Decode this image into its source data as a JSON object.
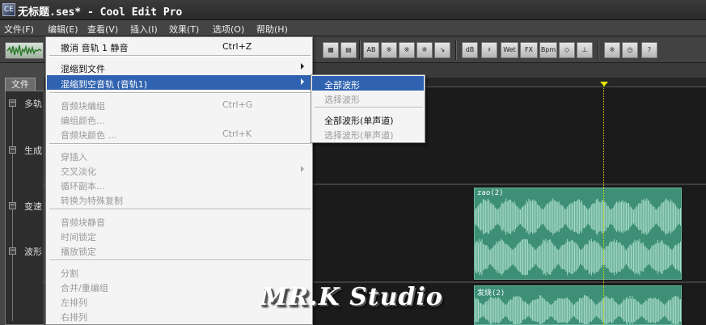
{
  "window": {
    "title": "无标题.ses* - Cool Edit Pro",
    "icon": "app-icon",
    "icon_glyph": "CE"
  },
  "menubar": [
    {
      "label": "文件(F)"
    },
    {
      "label": "编辑(E)"
    },
    {
      "label": "查看(V)"
    },
    {
      "label": "插入(I)"
    },
    {
      "label": "效果(T)"
    },
    {
      "label": "选项(O)"
    },
    {
      "label": "帮助(H)"
    }
  ],
  "toolbar": {
    "left_button": "waveform-icon",
    "buttons": [
      {
        "icon": "ab-icon",
        "glyph": "AB"
      },
      {
        "icon": "mix-wave-icon",
        "glyph": "※"
      },
      {
        "icon": "loop-a-icon",
        "glyph": "※"
      },
      {
        "icon": "loop-b-icon",
        "glyph": "※"
      },
      {
        "icon": "meter-icon",
        "glyph": "※"
      },
      {
        "icon": "arrow-icon",
        "glyph": "↘"
      },
      {
        "icon": "db-icon",
        "glyph": "dB"
      },
      {
        "icon": "pitch-icon",
        "glyph": "♯"
      },
      {
        "icon": "wet-icon",
        "glyph": "Wet"
      },
      {
        "icon": "fx-icon",
        "glyph": "FX"
      },
      {
        "icon": "bpm-icon",
        "glyph": "Bpm"
      },
      {
        "icon": "stretch-icon",
        "glyph": "◇"
      },
      {
        "icon": "split-icon",
        "glyph": "⊥"
      },
      {
        "icon": "settings-icon",
        "glyph": "※"
      },
      {
        "icon": "clock-icon",
        "glyph": "◷"
      },
      {
        "icon": "help-icon",
        "glyph": "?"
      }
    ],
    "ruler_buttons": [
      {
        "icon": "ruler-a-icon",
        "glyph": "▦"
      },
      {
        "icon": "ruler-b-icon",
        "glyph": "▤"
      },
      {
        "icon": "ruler-c-icon",
        "glyph": "▥"
      }
    ]
  },
  "left_panel": {
    "tab": "文件",
    "tree": [
      {
        "label": "多轨"
      },
      {
        "label": "生成"
      },
      {
        "label": "变速"
      },
      {
        "label": "波形"
      }
    ]
  },
  "edit_menu": {
    "items": [
      {
        "label": "撤消  音轨  1 静音",
        "shortcut": "Ctrl+Z",
        "enabled": true
      },
      {
        "label": "混缩到文件",
        "submenu": true,
        "enabled": true
      },
      {
        "label": "混缩到空音轨 (音轨1)",
        "submenu": true,
        "enabled": true,
        "highlighted": true
      },
      {
        "label": "音频块编组",
        "shortcut": "Ctrl+G",
        "enabled": false
      },
      {
        "label": "编组颜色...",
        "enabled": false
      },
      {
        "label": "音频块颜色 ...",
        "shortcut": "Ctrl+K",
        "enabled": false
      },
      {
        "label": "穿插入",
        "enabled": false
      },
      {
        "label": "交叉淡化",
        "submenu": true,
        "enabled": false
      },
      {
        "label": "循环副本...",
        "enabled": false
      },
      {
        "label": "转换为特殊复制",
        "enabled": false
      },
      {
        "label": "音频块静音",
        "enabled": false
      },
      {
        "label": "时间锁定",
        "enabled": false
      },
      {
        "label": "播放锁定",
        "enabled": false
      },
      {
        "label": "分割",
        "enabled": false
      },
      {
        "label": "合并/重编组",
        "enabled": false
      },
      {
        "label": "左排列",
        "enabled": false
      },
      {
        "label": "右排列",
        "enabled": false
      }
    ]
  },
  "submenu": {
    "items": [
      {
        "label": "全部波形",
        "enabled": true,
        "highlighted": true
      },
      {
        "label": "选择波形",
        "enabled": false
      },
      {
        "label": "全部波形(单声道)",
        "enabled": true
      },
      {
        "label": "选择波形(单声道)",
        "enabled": false
      }
    ]
  },
  "tracks": {
    "clips": [
      {
        "label": "zao(2)"
      },
      {
        "label": "发烧(2)"
      }
    ]
  },
  "watermark": "MR.K Studio",
  "colors": {
    "clip": "#3d8f76",
    "highlight": "#2f62b0",
    "playhead": "#e5e500"
  }
}
